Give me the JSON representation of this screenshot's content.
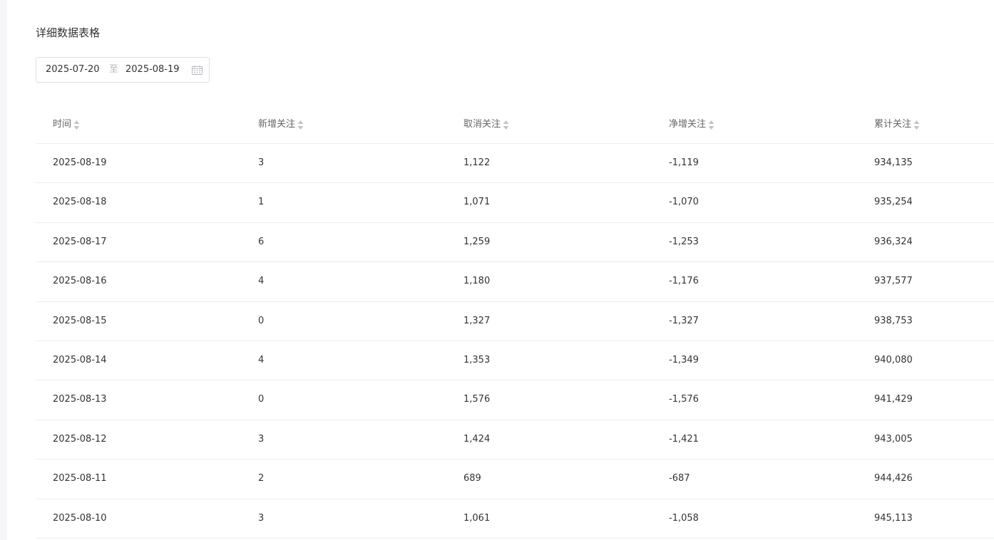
{
  "section_title": "详细数据表格",
  "date_range": {
    "start": "2025-07-20",
    "separator": "至",
    "end": "2025-08-19"
  },
  "table": {
    "columns": [
      "时间",
      "新增关注",
      "取消关注",
      "净增关注",
      "累计关注"
    ],
    "rows": [
      [
        "2025-08-19",
        "3",
        "1,122",
        "-1,119",
        "934,135"
      ],
      [
        "2025-08-18",
        "1",
        "1,071",
        "-1,070",
        "935,254"
      ],
      [
        "2025-08-17",
        "6",
        "1,259",
        "-1,253",
        "936,324"
      ],
      [
        "2025-08-16",
        "4",
        "1,180",
        "-1,176",
        "937,577"
      ],
      [
        "2025-08-15",
        "0",
        "1,327",
        "-1,327",
        "938,753"
      ],
      [
        "2025-08-14",
        "4",
        "1,353",
        "-1,349",
        "940,080"
      ],
      [
        "2025-08-13",
        "0",
        "1,576",
        "-1,576",
        "941,429"
      ],
      [
        "2025-08-12",
        "3",
        "1,424",
        "-1,421",
        "943,005"
      ],
      [
        "2025-08-11",
        "2",
        "689",
        "-687",
        "944,426"
      ],
      [
        "2025-08-10",
        "3",
        "1,061",
        "-1,058",
        "945,113"
      ]
    ]
  },
  "icons": {
    "calendar": "calendar-icon",
    "sort": "sort-caret-icon"
  },
  "colors": {
    "border": "#dcdfe6",
    "row_divider": "#ebeef5",
    "header_text": "#666666",
    "body_text": "#333333",
    "sort_icon": "#c0c4cc"
  }
}
